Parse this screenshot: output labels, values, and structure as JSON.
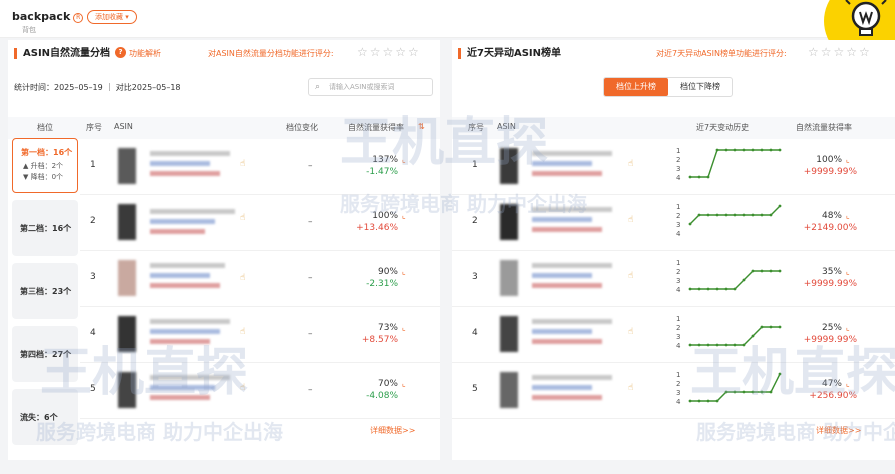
{
  "header": {
    "title": "backpack",
    "badge": "R",
    "favorite_label": "添加收藏 ▾",
    "subtitle": "背包"
  },
  "left": {
    "title": "ASIN自然流量分档",
    "help_label": "功能解析",
    "rate_label": "对ASIN自然流量分档功能进行评分:",
    "stars": "☆☆☆☆☆",
    "stat_time": "统计时间：2025–05–19 ｜ 对比2025–05–18",
    "search_placeholder": "请输入ASIN或搜索词",
    "columns": {
      "tier": "档位",
      "index": "序号",
      "asin": "ASIN",
      "tier_change": "档位变化",
      "traffic": "自然流量获得率"
    },
    "tiers": [
      {
        "label": "第一档：16个",
        "up": "▲ 升档：2个",
        "down": "▼ 降档：0个"
      },
      {
        "label": "第二档：16个"
      },
      {
        "label": "第三档：23个"
      },
      {
        "label": "第四档：27个"
      },
      {
        "label": "流失：6个"
      }
    ],
    "rows": [
      {
        "idx": "1",
        "change": "–",
        "pct": "137%",
        "delta": "-1.47%",
        "dir": "down"
      },
      {
        "idx": "2",
        "change": "–",
        "pct": "100%",
        "delta": "+13.46%",
        "dir": "up"
      },
      {
        "idx": "3",
        "change": "–",
        "pct": "90%",
        "delta": "-2.31%",
        "dir": "down"
      },
      {
        "idx": "4",
        "change": "–",
        "pct": "73%",
        "delta": "+8.57%",
        "dir": "up"
      },
      {
        "idx": "5",
        "change": "–",
        "pct": "70%",
        "delta": "-4.08%",
        "dir": "down"
      }
    ],
    "more": "详细数据>>"
  },
  "right": {
    "title": "近7天异动ASIN榜单",
    "rate_label": "对近7天异动ASIN榜单功能进行评分:",
    "stars": "☆☆☆☆☆",
    "tab_up": "档位上升榜",
    "tab_down": "档位下降榜",
    "columns": {
      "index": "序号",
      "asin": "ASIN",
      "history": "近7天变动历史",
      "traffic": "自然流量获得率"
    },
    "y_ticks": [
      "1",
      "2",
      "3",
      "4"
    ],
    "rows": [
      {
        "idx": "1",
        "pct": "100%",
        "delta": "+9999.99%",
        "history": [
          4,
          4,
          4,
          1,
          1,
          1,
          1,
          1,
          1,
          1,
          1
        ]
      },
      {
        "idx": "2",
        "pct": "48%",
        "delta": "+2149.00%",
        "history": [
          3,
          2,
          2,
          2,
          2,
          2,
          2,
          2,
          2,
          2,
          1
        ]
      },
      {
        "idx": "3",
        "pct": "35%",
        "delta": "+9999.99%",
        "history": [
          4,
          4,
          4,
          4,
          4,
          4,
          3,
          2,
          2,
          2,
          2
        ]
      },
      {
        "idx": "4",
        "pct": "25%",
        "delta": "+9999.99%",
        "history": [
          4,
          4,
          4,
          4,
          4,
          4,
          4,
          3,
          2,
          2,
          2
        ]
      },
      {
        "idx": "5",
        "pct": "47%",
        "delta": "+256.90%",
        "history": [
          4,
          4,
          4,
          4,
          3,
          3,
          3,
          3,
          3,
          3,
          1
        ]
      }
    ],
    "more": "详细数据>>"
  },
  "watermark": {
    "brand": "王机直探",
    "slogan": "服务跨境电商 助力中企出海"
  },
  "colors": {
    "accent": "#f0692a",
    "line": "#3c8f2f",
    "up": "#e24a3b",
    "down": "#2c9e4b"
  }
}
